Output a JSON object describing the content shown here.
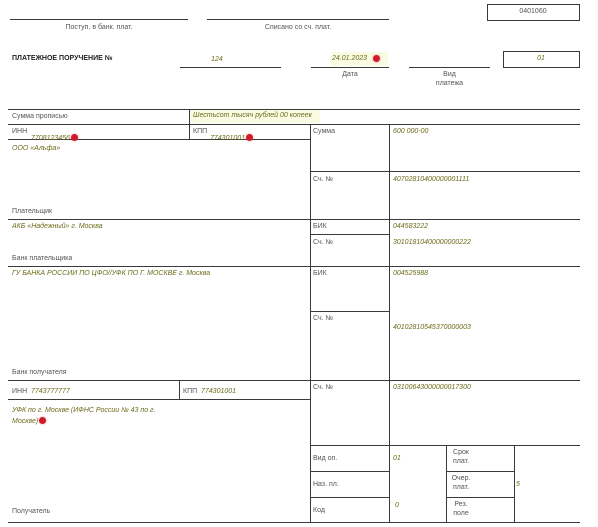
{
  "form_code": "0401060",
  "header": {
    "received_label": "Поступ. в банк. плат.",
    "debited_label": "Списано со сч. плат."
  },
  "doc": {
    "title": "ПЛАТЕЖНОЕ ПОРУЧЕНИЕ №",
    "number": "124",
    "date": "24.01.2023",
    "date_label": "Дата",
    "payment_type_label": "Вид\nплатежа",
    "status": "01"
  },
  "amount_words": {
    "label": "Сумма прописью",
    "value": "Шестьсот тысяч рублей 00 копеек"
  },
  "payer": {
    "inn_label": "ИНН",
    "inn": "7708123456",
    "kpp_label": "КПП",
    "kpp": "774301001",
    "name": "ООО «Альфа»",
    "label": "Плательщик"
  },
  "amount": {
    "label": "Сумма",
    "value": "600 000-00"
  },
  "account_label": "Сч. №",
  "payer_account": "40702810400000001111",
  "payer_bank": {
    "name": "АКБ «Надежный» г. Москва",
    "label": "Банк плательщика",
    "bik_label": "БИК",
    "bik": "044583222",
    "corr_account": "30101810400000000222"
  },
  "payee_bank": {
    "name": "ГУ БАНКА РОССИИ ПО ЦФО//УФК ПО Г. МОСКВЕ г. Москва",
    "label": "Банк получателя",
    "bik_label": "БИК",
    "bik": "004525988",
    "corr_account": "40102810545370000003"
  },
  "payee": {
    "inn_label": "ИНН",
    "inn": "7743777777",
    "kpp_label": "КПП",
    "kpp": "774301001",
    "name": "УФК по г. Москве (ИФНС России № 43 по г. Москве)",
    "label": "Получатель",
    "account": "03100643000000017300"
  },
  "details": {
    "op_type_label": "Вид оп.",
    "op_type": "01",
    "term_label": "Срок\nплат.",
    "purpose_label": "Наз. пл.",
    "priority_label": "Очер.\nплат.",
    "priority": "5",
    "code_label": "Код",
    "code": "0",
    "reserve_label": "Рез.\nполе"
  },
  "colors": {
    "field_value": "#6b6b1a",
    "marker": "#d31a2b",
    "line": "#3a3a3a"
  }
}
